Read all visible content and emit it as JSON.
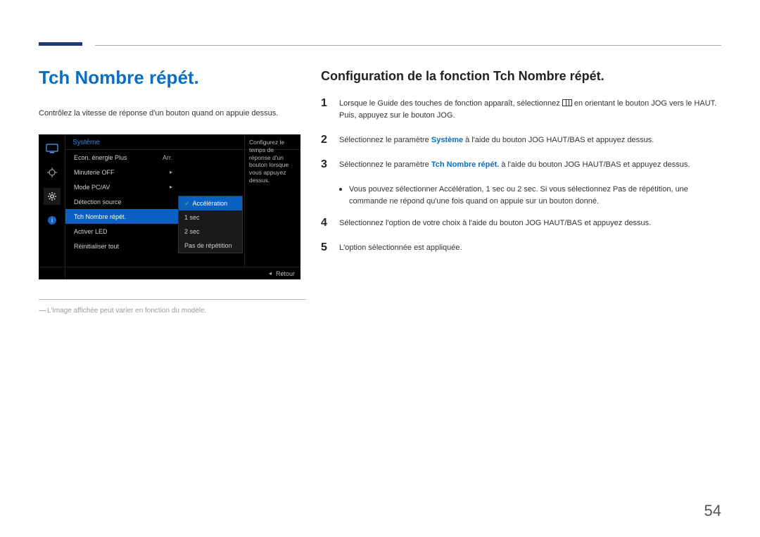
{
  "page": {
    "number": "54"
  },
  "left": {
    "heading": "Tch Nombre répét.",
    "intro": "Contrôlez la vitesse de réponse d'un bouton quand on appuie dessus.",
    "footnote": "L'image affichée peut varier en fonction du modèle."
  },
  "osd": {
    "title": "Système",
    "menu": [
      {
        "label": "Econ. énergie Plus",
        "value": "Arr."
      },
      {
        "label": "Minuterie OFF",
        "value": "▸"
      },
      {
        "label": "Mode PC/AV",
        "value": "▸"
      },
      {
        "label": "Détection source",
        "value": ""
      },
      {
        "label": "Tch Nombre répét.",
        "value": ""
      },
      {
        "label": "Activer LED",
        "value": ""
      },
      {
        "label": "Réinitialiser tout",
        "value": ""
      }
    ],
    "selected_menu_index": 4,
    "submenu": [
      "Accélération",
      "1 sec",
      "2 sec",
      "Pas de répétition"
    ],
    "selected_submenu_index": 0,
    "description": "Configurez le temps de réponse d'un bouton lorsque vous appuyez dessus.",
    "footer": {
      "back_label": "Retour"
    }
  },
  "right": {
    "heading": "Configuration de la fonction Tch Nombre répét.",
    "steps": {
      "s1_a": "Lorsque le Guide des touches de fonction apparaît, sélectionnez ",
      "s1_b": " en orientant le bouton JOG vers le HAUT. Puis, appuyez sur le bouton JOG.",
      "s2_a": "Sélectionnez le paramètre ",
      "s2_hl": "Système",
      "s2_b": " à l'aide du bouton JOG HAUT/BAS et appuyez dessus.",
      "s3_a": "Sélectionnez le paramètre ",
      "s3_hl": "Tch Nombre répét.",
      "s3_b": " à l'aide du bouton JOG HAUT/BAS et appuyez dessus.",
      "bullet_a": "Vous pouvez sélectionner ",
      "bullet_h1": "Accélération",
      "bullet_sep1": ", ",
      "bullet_h2": "1 sec",
      "bullet_sep2": " ou ",
      "bullet_h3": "2 sec",
      "bullet_mid": ". Si vous sélectionnez ",
      "bullet_h4": "Pas de répétition",
      "bullet_b": ", une commande ne répond qu'une fois quand on appuie sur un bouton donné.",
      "s4": "Sélectionnez l'option de votre choix à l'aide du bouton JOG HAUT/BAS et appuyez dessus.",
      "s5": "L'option sélectionnée est appliquée."
    }
  }
}
